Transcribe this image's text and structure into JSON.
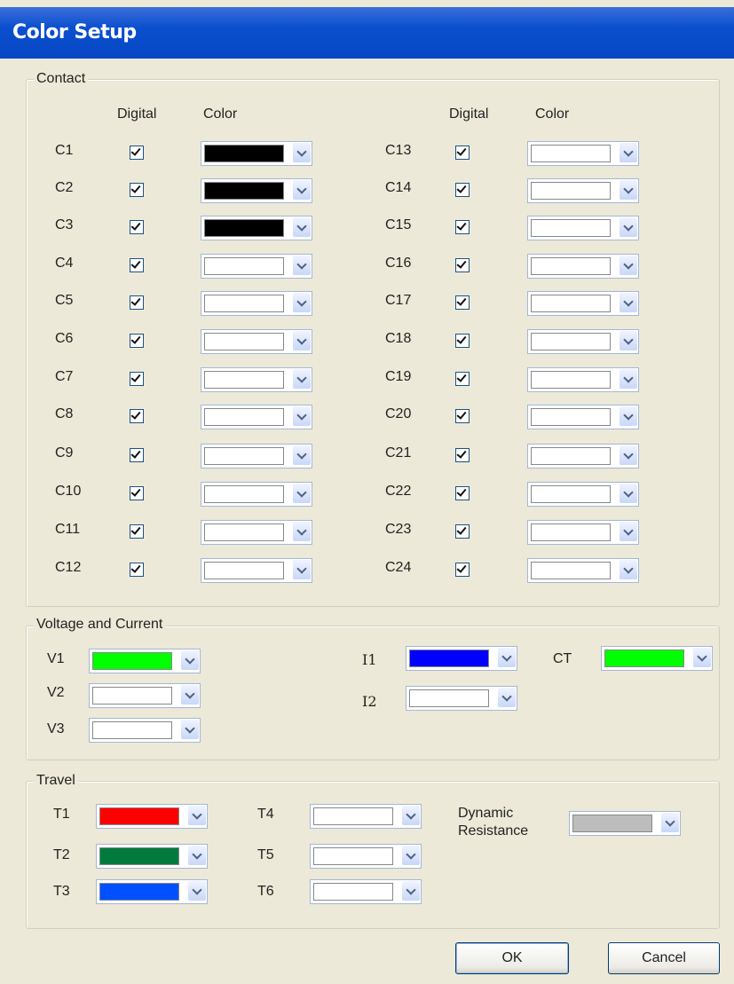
{
  "window": {
    "title": "Color Setup"
  },
  "colors": {
    "black": "#000000",
    "white": "#ffffff",
    "green": "#00ff00",
    "blue": "#0000ff",
    "red": "#ff0000",
    "dark_green": "#007a3d",
    "mid_blue": "#0050ff",
    "gray": "#bdbdbd"
  },
  "contact": {
    "legend": "Contact",
    "col_digital": "Digital",
    "col_color": "Color",
    "left": [
      {
        "label": "C1",
        "digital": true,
        "color": "#000000"
      },
      {
        "label": "C2",
        "digital": true,
        "color": "#000000"
      },
      {
        "label": "C3",
        "digital": true,
        "color": "#000000"
      },
      {
        "label": "C4",
        "digital": true,
        "color": "#ffffff"
      },
      {
        "label": "C5",
        "digital": true,
        "color": "#ffffff"
      },
      {
        "label": "C6",
        "digital": true,
        "color": "#ffffff"
      },
      {
        "label": "C7",
        "digital": true,
        "color": "#ffffff"
      },
      {
        "label": "C8",
        "digital": true,
        "color": "#ffffff"
      },
      {
        "label": "C9",
        "digital": true,
        "color": "#ffffff"
      },
      {
        "label": "C10",
        "digital": true,
        "color": "#ffffff"
      },
      {
        "label": "C11",
        "digital": true,
        "color": "#ffffff"
      },
      {
        "label": "C12",
        "digital": true,
        "color": "#ffffff"
      }
    ],
    "right": [
      {
        "label": "C13",
        "digital": true,
        "color": "#ffffff"
      },
      {
        "label": "C14",
        "digital": true,
        "color": "#ffffff"
      },
      {
        "label": "C15",
        "digital": true,
        "color": "#ffffff"
      },
      {
        "label": "C16",
        "digital": true,
        "color": "#ffffff"
      },
      {
        "label": "C17",
        "digital": true,
        "color": "#ffffff"
      },
      {
        "label": "C18",
        "digital": true,
        "color": "#ffffff"
      },
      {
        "label": "C19",
        "digital": true,
        "color": "#ffffff"
      },
      {
        "label": "C20",
        "digital": true,
        "color": "#ffffff"
      },
      {
        "label": "C21",
        "digital": true,
        "color": "#ffffff"
      },
      {
        "label": "C22",
        "digital": true,
        "color": "#ffffff"
      },
      {
        "label": "C23",
        "digital": true,
        "color": "#ffffff"
      },
      {
        "label": "C24",
        "digital": true,
        "color": "#ffffff"
      }
    ]
  },
  "vc": {
    "legend": "Voltage and Current",
    "v1": {
      "label": "V1",
      "color": "#00ff00"
    },
    "v2": {
      "label": "V2",
      "color": "#ffffff"
    },
    "v3": {
      "label": "V3",
      "color": "#ffffff"
    },
    "i1": {
      "label": "I1",
      "color": "#0000ff"
    },
    "i2": {
      "label": "I2",
      "color": "#ffffff"
    },
    "ct": {
      "label": "CT",
      "color": "#00ff00"
    }
  },
  "travel": {
    "legend": "Travel",
    "t1": {
      "label": "T1",
      "color": "#ff0000"
    },
    "t2": {
      "label": "T2",
      "color": "#007a3d"
    },
    "t3": {
      "label": "T3",
      "color": "#0050ff"
    },
    "t4": {
      "label": "T4",
      "color": "#ffffff"
    },
    "t5": {
      "label": "T5",
      "color": "#ffffff"
    },
    "t6": {
      "label": "T6",
      "color": "#ffffff"
    },
    "dynamic_resistance": {
      "label": "Dynamic Resistance",
      "color": "#bdbdbd"
    }
  },
  "buttons": {
    "ok": "OK",
    "cancel": "Cancel"
  }
}
